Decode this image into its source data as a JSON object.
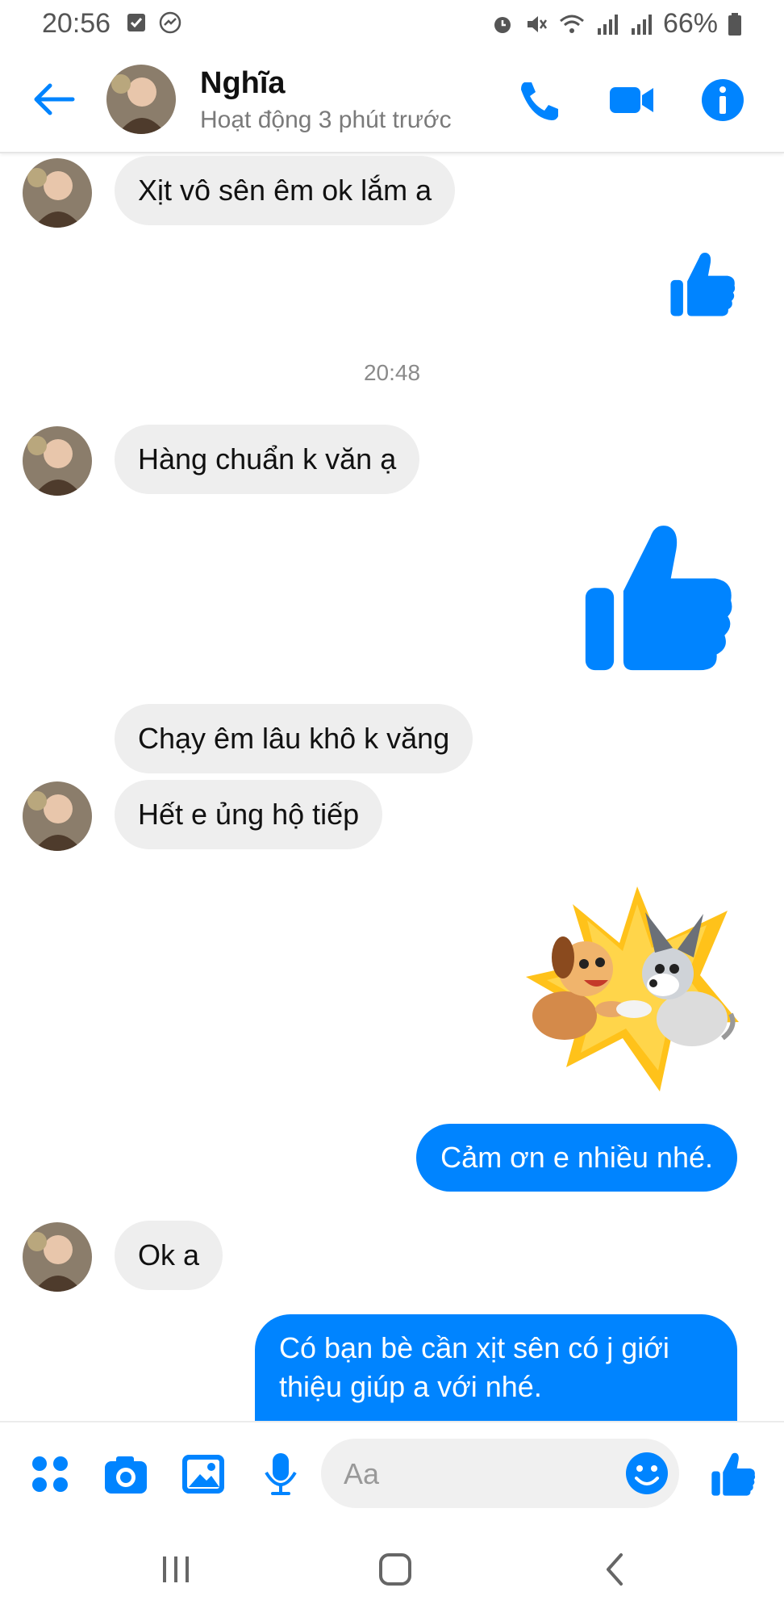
{
  "status_bar": {
    "time": "20:56",
    "battery": "66%"
  },
  "header": {
    "contact_name": "Nghĩa",
    "contact_status": "Hoạt động 3 phút trước"
  },
  "messages": {
    "m1": "Xịt vô sên êm ok lắm a",
    "timestamp": "20:48",
    "m2": "Hàng chuẩn k văn ạ",
    "m3": "Chạy êm lâu khô k văng",
    "m4": "Hết e ủng hộ tiếp",
    "m5": "Cảm ơn e nhiều nhé.",
    "m6": "Ok a",
    "m7": "Có bạn bè cần xịt sên có j giới thiệu giúp a với nhé."
  },
  "composer": {
    "placeholder": "Aa"
  },
  "colors": {
    "accent": "#0084ff",
    "incoming_bubble": "#eeeeee"
  },
  "icons": [
    "back-arrow-icon",
    "phone-icon",
    "video-icon",
    "info-icon",
    "apps-icon",
    "camera-icon",
    "gallery-icon",
    "mic-icon",
    "emoji-icon",
    "like-icon"
  ]
}
